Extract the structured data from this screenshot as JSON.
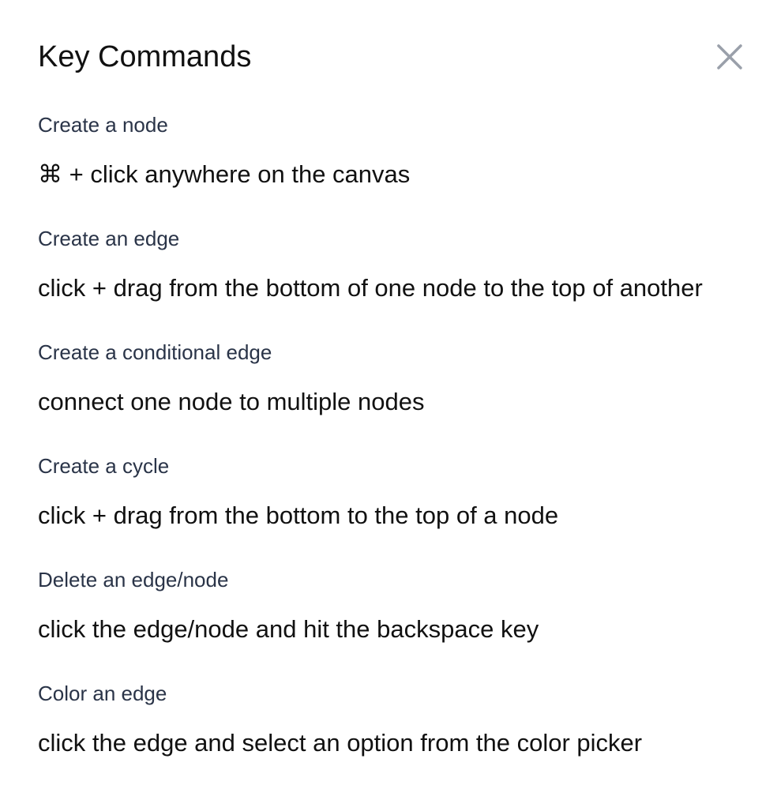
{
  "dialog": {
    "title": "Key Commands",
    "close_icon": "close-icon",
    "close_icon_color": "#9aa0aa"
  },
  "commands": [
    {
      "label": "Create a node",
      "description": "⌘ + click anywhere on the canvas"
    },
    {
      "label": "Create an edge",
      "description": "click + drag from the bottom of one node to the top of another"
    },
    {
      "label": "Create a conditional edge",
      "description": "connect one node to multiple nodes"
    },
    {
      "label": "Create a cycle",
      "description": "click + drag from the bottom to the top of a node"
    },
    {
      "label": "Delete an edge/node",
      "description": "click the edge/node and hit the backspace key"
    },
    {
      "label": "Color an edge",
      "description": "click the edge and select an option from the color picker"
    }
  ]
}
